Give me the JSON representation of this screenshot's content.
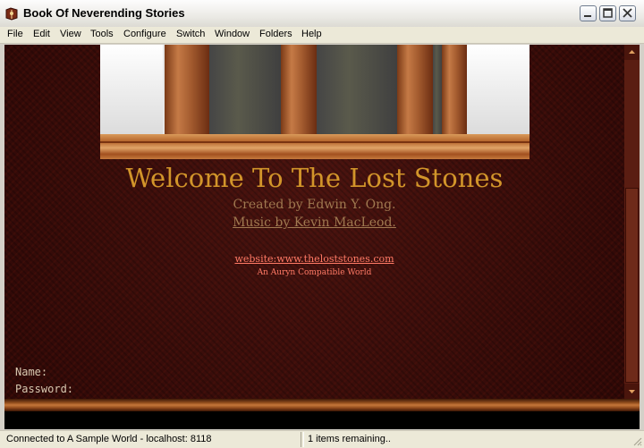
{
  "window": {
    "title": "Book Of Neverending Stories",
    "app_icon": "book-app-icon",
    "controls": [
      "minimize-icon",
      "maximize-icon",
      "close-icon"
    ]
  },
  "menu": {
    "items": [
      "File",
      "Edit",
      "View",
      "Tools",
      "Configure",
      "Switch",
      "Window",
      "Folders",
      "Help"
    ]
  },
  "content": {
    "welcome": "Welcome To The Lost Stones",
    "created_by": "Created by Edwin Y. Ong.",
    "music_by": "Music by Kevin MacLeod.",
    "website": "website:www.theloststones.com",
    "compat": "An Auryn Compatible World",
    "name_label": "Name:",
    "password_label": "Password:"
  },
  "status": {
    "connection": "Connected to A Sample World - localhost: 8118",
    "items": "1 items remaining.."
  },
  "colors": {
    "heading": "#d2952a",
    "subtext": "#a07950",
    "link": "#ff7a66",
    "background": "#3a0c08"
  }
}
